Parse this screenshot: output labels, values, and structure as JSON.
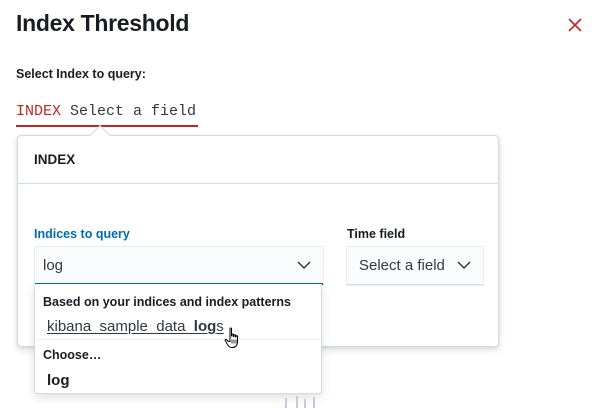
{
  "flyout": {
    "title": "Index Threshold",
    "close_icon": "close-icon",
    "section_label": "Select Index to query:"
  },
  "expression": {
    "keyword": "INDEX",
    "value": "Select a field"
  },
  "popover": {
    "title": "INDEX",
    "indices_label": "Indices to query",
    "indices_value": "log",
    "time_field_label": "Time field",
    "time_field_value": "Select a field"
  },
  "dropdown": {
    "group1_title": "Based on your indices and index patterns",
    "option1_prefix": "kibana_sample_data_",
    "option1_match": "log",
    "option1_suffix": "s",
    "group2_title": "Choose…",
    "option2": "log"
  },
  "colors": {
    "accent": "#006bb4",
    "danger": "#bd271e",
    "text": "#1a1c21"
  }
}
